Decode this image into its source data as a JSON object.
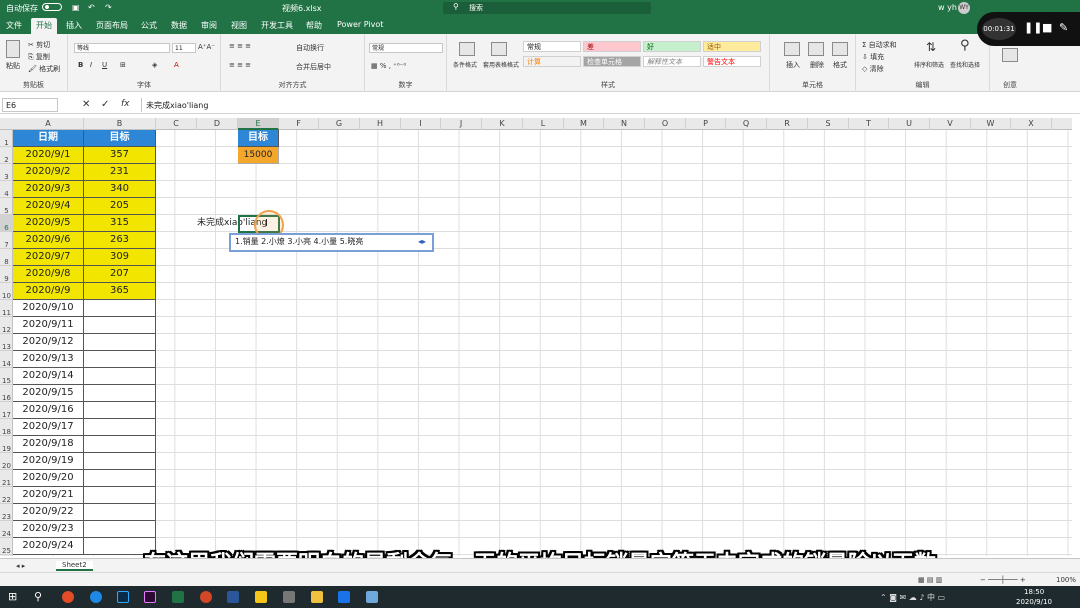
{
  "titlebar": {
    "autosave": "自动保存",
    "filename": "视频6.xlsx",
    "search": "搜索",
    "user": "w yh",
    "avatar": "WY"
  },
  "tabs": [
    "文件",
    "开始",
    "插入",
    "页面布局",
    "公式",
    "数据",
    "审阅",
    "视图",
    "开发工具",
    "帮助",
    "Power Pivot"
  ],
  "active_tab": "开始",
  "ribbon": {
    "clipboard": {
      "label": "剪贴板",
      "paste": "粘贴",
      "cut": "剪切",
      "copy": "复制",
      "format_painter": "格式刷"
    },
    "font": {
      "label": "字体",
      "name": "等线",
      "size": "11"
    },
    "alignment": {
      "label": "对齐方式",
      "wrap": "自动换行",
      "merge": "合并后居中"
    },
    "number": {
      "label": "数字",
      "format": "常规"
    },
    "styles": {
      "label": "样式",
      "cond": "条件格式",
      "table": "套用表格格式",
      "cells": [
        "常规",
        "差",
        "好",
        "适中",
        "计算",
        "检查单元格",
        "解释性文本",
        "警告文本"
      ]
    },
    "cellsgrp": {
      "label": "单元格",
      "insert": "插入",
      "delete": "删除",
      "format": "格式"
    },
    "editing": {
      "label": "编辑",
      "autosum": "自动求和",
      "fill": "填充",
      "clear": "清除",
      "sort": "排序和筛选",
      "find": "查找和选择"
    },
    "create": {
      "label": "创意"
    }
  },
  "formula_bar": {
    "name_box": "E6",
    "content": "未完成xiao'liang"
  },
  "columns": [
    "A",
    "B",
    "C",
    "D",
    "E",
    "F",
    "G",
    "H",
    "I",
    "J",
    "K",
    "L",
    "M",
    "N",
    "O",
    "P",
    "Q",
    "R",
    "S",
    "T",
    "U",
    "V",
    "W",
    "X"
  ],
  "rows": [
    "1",
    "2",
    "3",
    "4",
    "5",
    "6",
    "7",
    "8",
    "9",
    "10",
    "11",
    "12",
    "13",
    "14",
    "15",
    "16",
    "17",
    "18",
    "19",
    "20",
    "21",
    "22",
    "23",
    "24",
    "25"
  ],
  "table": {
    "header_date": "日期",
    "header_target": "目标",
    "dates": [
      "2020/9/1",
      "2020/9/2",
      "2020/9/3",
      "2020/9/4",
      "2020/9/5",
      "2020/9/6",
      "2020/9/7",
      "2020/9/8",
      "2020/9/9",
      "2020/9/10",
      "2020/9/11",
      "2020/9/12",
      "2020/9/13",
      "2020/9/14",
      "2020/9/15",
      "2020/9/16",
      "2020/9/17",
      "2020/9/18",
      "2020/9/19",
      "2020/9/20",
      "2020/9/21",
      "2020/9/22",
      "2020/9/23",
      "2020/9/24"
    ],
    "targets": [
      "357",
      "231",
      "340",
      "205",
      "315",
      "263",
      "309",
      "207",
      "365"
    ]
  },
  "target_box": {
    "header": "目标",
    "value": "15000"
  },
  "editing_cell": "未完成xiao'liang",
  "ime_candidates": "1.销量 2.小燎 3.小亮 4.小量 5.晓亮",
  "sheet_tab": "Sheet2",
  "recorder": {
    "time": "00:01:31"
  },
  "clock": {
    "time": "18:50",
    "date": "2020/9/10"
  },
  "subtitle": "在这里我们需要明白的是剩余每一天的平均目标销量它等于未完成的销量除以天数",
  "zoom": "100%"
}
